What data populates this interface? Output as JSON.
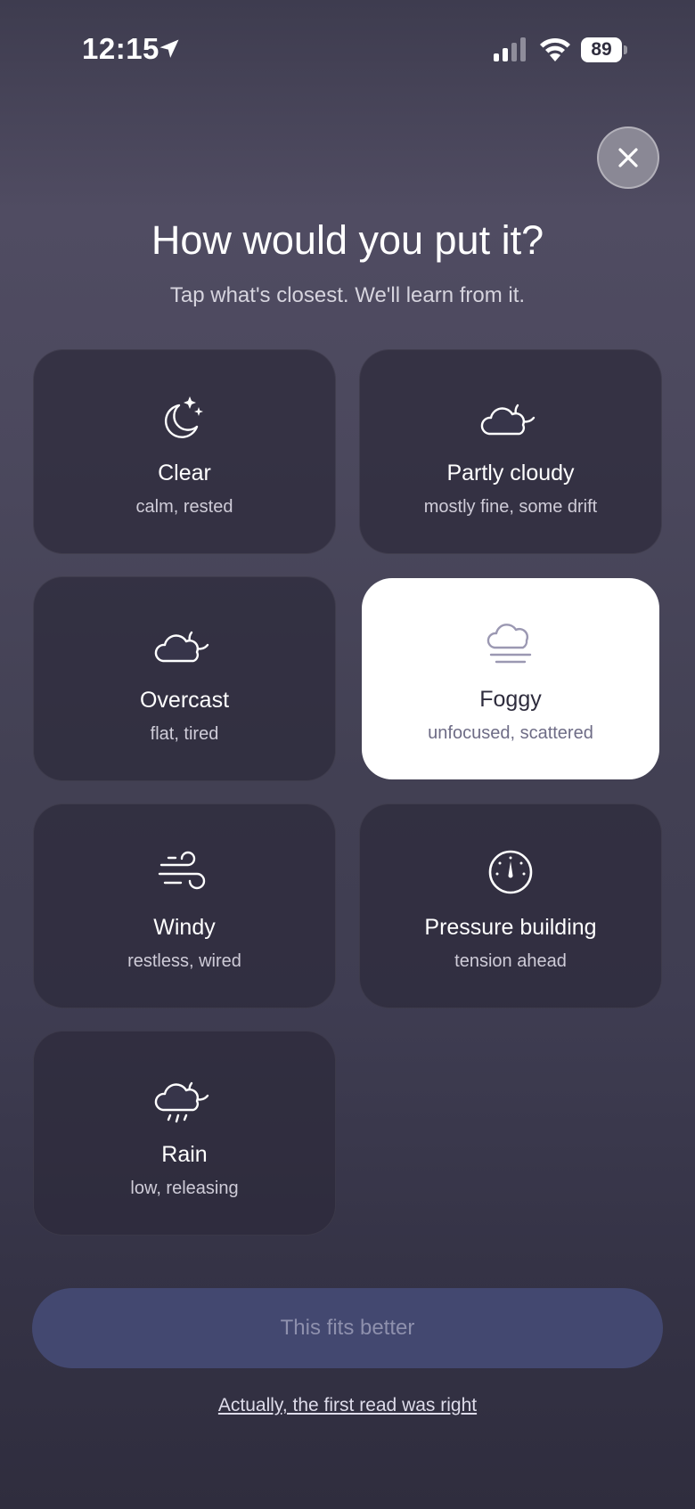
{
  "status_bar": {
    "time": "12:15",
    "battery": "89",
    "icons": [
      "location-arrow-icon",
      "cellular-signal-icon",
      "wifi-icon",
      "battery-icon"
    ]
  },
  "close": {
    "icon": "close-icon"
  },
  "header": {
    "title": "How would you put it?",
    "subtitle": "Tap what's closest. We'll learn from it."
  },
  "options": [
    {
      "label": "Clear",
      "description": "calm, rested",
      "icon": "moon-stars-icon",
      "selected": false
    },
    {
      "label": "Partly cloudy",
      "description": "mostly fine, some drift",
      "icon": "cloud-moon-icon",
      "selected": false
    },
    {
      "label": "Overcast",
      "description": "flat, tired",
      "icon": "cloud-moon-icon",
      "selected": false
    },
    {
      "label": "Foggy",
      "description": "unfocused, scattered",
      "icon": "fog-icon",
      "selected": true
    },
    {
      "label": "Windy",
      "description": "restless, wired",
      "icon": "wind-icon",
      "selected": false
    },
    {
      "label": "Pressure building",
      "description": "tension ahead",
      "icon": "gauge-icon",
      "selected": false
    },
    {
      "label": "Rain",
      "description": "low, releasing",
      "icon": "cloud-moon-rain-icon",
      "selected": false
    }
  ],
  "actions": {
    "primary_label": "This fits better",
    "secondary_label": "Actually, the first read was right"
  },
  "colors": {
    "background_top": "#504c62",
    "background_bottom": "#2f2d3e",
    "card": "#2c2a3a",
    "selected_card": "#ffffff",
    "primary_button": "#434870",
    "primary_button_text": "#8e90ad"
  }
}
